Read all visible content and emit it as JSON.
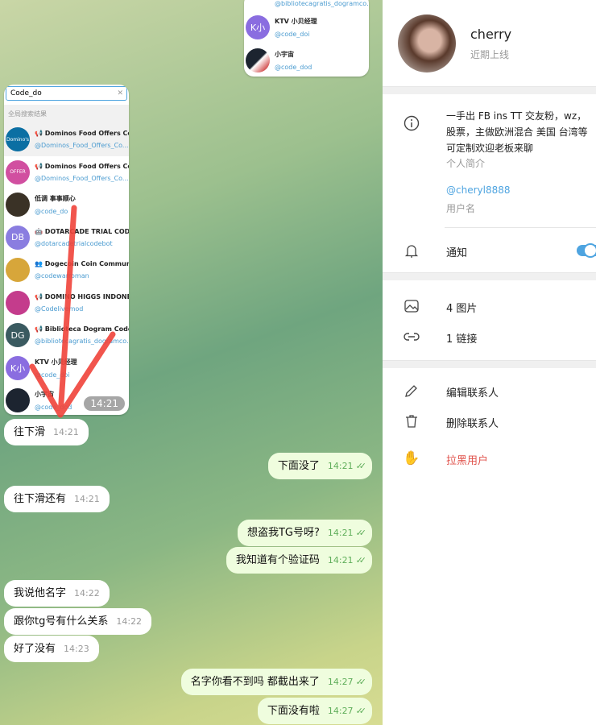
{
  "search_screenshot": {
    "query": "Code_do",
    "section_label": "全局搜索结果",
    "time": "14:21",
    "results": [
      {
        "name": "📢 Dominos Food Offers Co...",
        "username": "@Dominos_Food_Offers_Co...",
        "avatar_color": "#0b6fa3",
        "avatar_text": "Domino's"
      },
      {
        "name": "📢 Dominos Food Offers Co...",
        "username": "@Dominos_Food_Offers_Co...",
        "avatar_color": "#d14fa0",
        "avatar_text": "OFFER"
      },
      {
        "name": "低调 事事顺心",
        "username": "@code_do",
        "avatar_color": "#3a3226",
        "avatar_text": ""
      },
      {
        "name": "🤖 DOTARCADE TRIAL COD...",
        "username": "@dotarcadetrialcodebot",
        "avatar_color": "#8a7de0",
        "avatar_text": "DB"
      },
      {
        "name": "👥 Dogecoin Coin Commun...",
        "username": "@codewarroman",
        "avatar_color": "#d7a63a",
        "avatar_text": ""
      },
      {
        "name": "📢 DOMINO HIGGS INDONE...",
        "username": "@Codelivemod",
        "avatar_color": "#c43c8c",
        "avatar_text": ""
      },
      {
        "name": "📢 Biblioteca Dogram Code",
        "username": "@bibliotecagratis_dogramco...",
        "avatar_color": "#3a5a60",
        "avatar_text": "DG"
      },
      {
        "name": "KTV 小贝经理",
        "username": "@code_doi",
        "avatar_color": "#8a6de0",
        "avatar_text": "K小"
      },
      {
        "name": "小宇宙",
        "username": "@code_dod",
        "avatar_color": "#1c2430",
        "avatar_text": ""
      }
    ]
  },
  "top_screenshot": {
    "results": [
      {
        "username": "@bibliotecagratis_dogramco..."
      },
      {
        "name": "KTV 小贝经理",
        "username": "@code_doi",
        "avatar_text": "K小",
        "avatar_color": "#8a6de0"
      },
      {
        "name": "小宇宙",
        "username": "@code_dod",
        "avatar_color": "#1c2430"
      }
    ]
  },
  "messages": [
    {
      "dir": "in",
      "text": "往下滑",
      "time": "14:21"
    },
    {
      "dir": "out",
      "text": "下面没了",
      "time": "14:21"
    },
    {
      "dir": "in",
      "text": "往下滑还有",
      "time": "14:21"
    },
    {
      "dir": "out",
      "text": "想盗我TG号呀?",
      "time": "14:21"
    },
    {
      "dir": "out",
      "text": "我知道有个验证码",
      "time": "14:21"
    },
    {
      "dir": "in",
      "text": "我说他名字",
      "time": "14:22"
    },
    {
      "dir": "in",
      "text": "跟你tg号有什么关系",
      "time": "14:22"
    },
    {
      "dir": "in",
      "text": "好了没有",
      "time": "14:23"
    },
    {
      "dir": "out",
      "text": "名字你看不到吗 都截出来了",
      "time": "14:27"
    },
    {
      "dir": "out",
      "text": "下面没有啦",
      "time": "14:27"
    }
  ],
  "profile": {
    "name": "cherry",
    "status": "近期上线",
    "bio": "一手出 FB ins TT 交友粉，wz，股票，主做欧洲混合 美国 台湾等可定制欢迎老板来聊",
    "bio_label": "个人简介",
    "username": "@cheryl8888",
    "username_label": "用户名",
    "notifications_label": "通知",
    "notifications_on": true,
    "photos": "4 图片",
    "links": "1 链接",
    "edit_contact": "编辑联系人",
    "delete_contact": "删除联系人",
    "block_user": "拉黑用户",
    "accent": "#4ea4e0",
    "danger": "#e0534c"
  }
}
